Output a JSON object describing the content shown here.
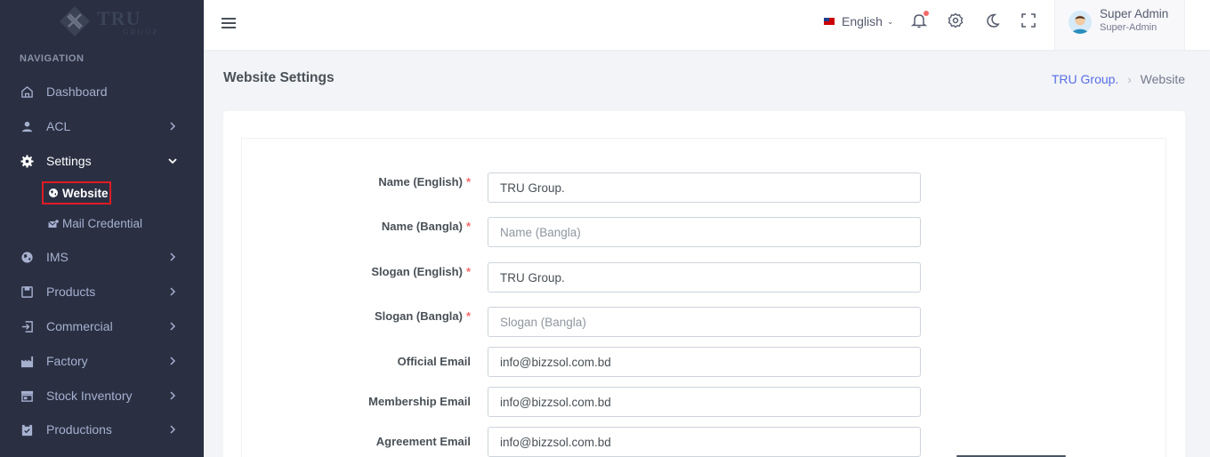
{
  "brand": {
    "name": "TRU",
    "sub": "GROUP"
  },
  "sidebar": {
    "nav_title": "NAVIGATION",
    "items": [
      {
        "label": "Dashboard"
      },
      {
        "label": "ACL"
      },
      {
        "label": "Settings"
      },
      {
        "label": "IMS"
      },
      {
        "label": "Products"
      },
      {
        "label": "Commercial"
      },
      {
        "label": "Factory"
      },
      {
        "label": "Stock Inventory"
      },
      {
        "label": "Productions"
      }
    ],
    "settings_sub": [
      {
        "label": "Website"
      },
      {
        "label": "Mail Credential"
      }
    ]
  },
  "topbar": {
    "language": "English",
    "user_name": "Super Admin",
    "user_role": "Super-Admin"
  },
  "page": {
    "title": "Website Settings",
    "breadcrumb": [
      "TRU Group.",
      "Website"
    ]
  },
  "form": {
    "name_en": {
      "label": "Name (English)",
      "value": "TRU Group.",
      "placeholder": ""
    },
    "name_bn": {
      "label": "Name (Bangla)",
      "value": "",
      "placeholder": "Name (Bangla)"
    },
    "slogan_en": {
      "label": "Slogan (English)",
      "value": "TRU Group.",
      "placeholder": ""
    },
    "slogan_bn": {
      "label": "Slogan (Bangla)",
      "value": "",
      "placeholder": "Slogan (Bangla)"
    },
    "official_email": {
      "label": "Official Email",
      "value": "info@bizzsol.com.bd"
    },
    "membership_email": {
      "label": "Membership Email",
      "value": "info@bizzsol.com.bd"
    },
    "agreement_email": {
      "label": "Agreement Email",
      "value": "info@bizzsol.com.bd"
    }
  }
}
